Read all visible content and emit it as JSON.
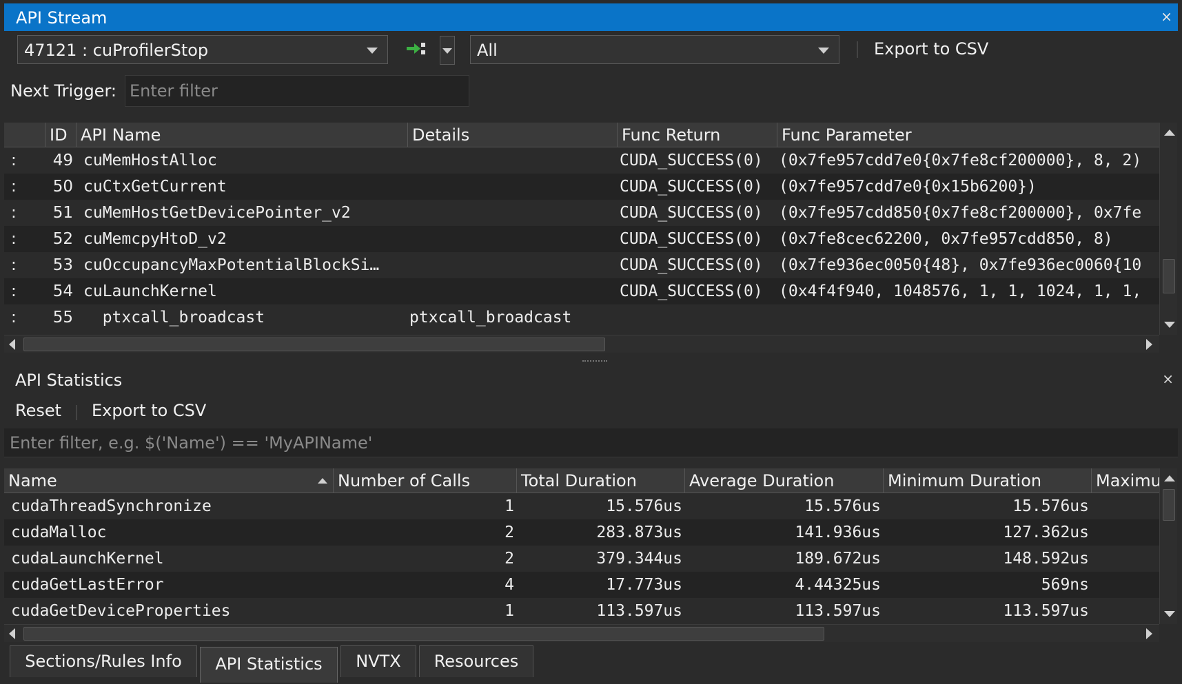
{
  "stream": {
    "title": "API Stream",
    "close_glyph": "×",
    "api_select": "47121 : cuProfilerStop",
    "filter_select": "All",
    "export_label": "Export to CSV",
    "next_trigger_label": "Next Trigger:",
    "next_trigger_placeholder": "Enter filter",
    "columns": [
      "",
      "ID",
      "API Name",
      "Details",
      "Func Return",
      "Func Parameter"
    ],
    "rows": [
      {
        "marker": ":",
        "id": "49",
        "name": "cuMemHostAlloc",
        "details": "",
        "ret": "CUDA_SUCCESS(0)",
        "param": "(0x7fe957cdd7e0{0x7fe8cf200000}, 8, 2)"
      },
      {
        "marker": ":",
        "id": "50",
        "name": "cuCtxGetCurrent",
        "details": "",
        "ret": "CUDA_SUCCESS(0)",
        "param": "(0x7fe957cdd7e0{0x15b6200})"
      },
      {
        "marker": ":",
        "id": "51",
        "name": "cuMemHostGetDevicePointer_v2",
        "details": "",
        "ret": "CUDA_SUCCESS(0)",
        "param": "(0x7fe957cdd850{0x7fe8cf200000}, 0x7fe"
      },
      {
        "marker": ":",
        "id": "52",
        "name": "cuMemcpyHtoD_v2",
        "details": "",
        "ret": "CUDA_SUCCESS(0)",
        "param": "(0x7fe8cec62200, 0x7fe957cdd850, 8)"
      },
      {
        "marker": ":",
        "id": "53",
        "name": "cuOccupancyMaxPotentialBlockSi…",
        "details": "",
        "ret": "CUDA_SUCCESS(0)",
        "param": "(0x7fe936ec0050{48}, 0x7fe936ec0060{10"
      },
      {
        "marker": ":",
        "id": "54",
        "name": "cuLaunchKernel",
        "details": "",
        "ret": "CUDA_SUCCESS(0)",
        "param": "(0x4f4f940, 1048576, 1, 1, 1024, 1, 1,"
      },
      {
        "marker": ":",
        "id": "55",
        "name": "  ptxcall_broadcast",
        "details": "ptxcall_broadcast",
        "ret": "",
        "param": ""
      }
    ]
  },
  "stats": {
    "title": "API Statistics",
    "close_glyph": "×",
    "reset_label": "Reset",
    "export_label": "Export to CSV",
    "filter_placeholder": "Enter filter, e.g. $('Name') == 'MyAPIName'",
    "columns": [
      "Name",
      "Number of Calls",
      "Total Duration",
      "Average Duration",
      "Minimum Duration",
      "Maximu"
    ],
    "rows": [
      {
        "name": "cudaThreadSynchronize",
        "calls": "1",
        "total": "15.576us",
        "avg": "15.576us",
        "min": "15.576us"
      },
      {
        "name": "cudaMalloc",
        "calls": "2",
        "total": "283.873us",
        "avg": "141.936us",
        "min": "127.362us"
      },
      {
        "name": "cudaLaunchKernel",
        "calls": "2",
        "total": "379.344us",
        "avg": "189.672us",
        "min": "148.592us"
      },
      {
        "name": "cudaGetLastError",
        "calls": "4",
        "total": "17.773us",
        "avg": "4.44325us",
        "min": "569ns"
      },
      {
        "name": "cudaGetDeviceProperties",
        "calls": "1",
        "total": "113.597us",
        "avg": "113.597us",
        "min": "113.597us"
      }
    ]
  },
  "tabs": [
    {
      "label": "Sections/Rules Info",
      "active": false
    },
    {
      "label": "API Statistics",
      "active": true
    },
    {
      "label": "NVTX",
      "active": false
    },
    {
      "label": "Resources",
      "active": false
    }
  ],
  "colors": {
    "title_bar": "#0a74c8",
    "trigger_icon_green": "#3cb043"
  },
  "icons": [
    "close-icon",
    "dropdown-arrow-icon",
    "next-trigger-icon",
    "sort-ascending-icon",
    "scroll-arrow-icon"
  ]
}
